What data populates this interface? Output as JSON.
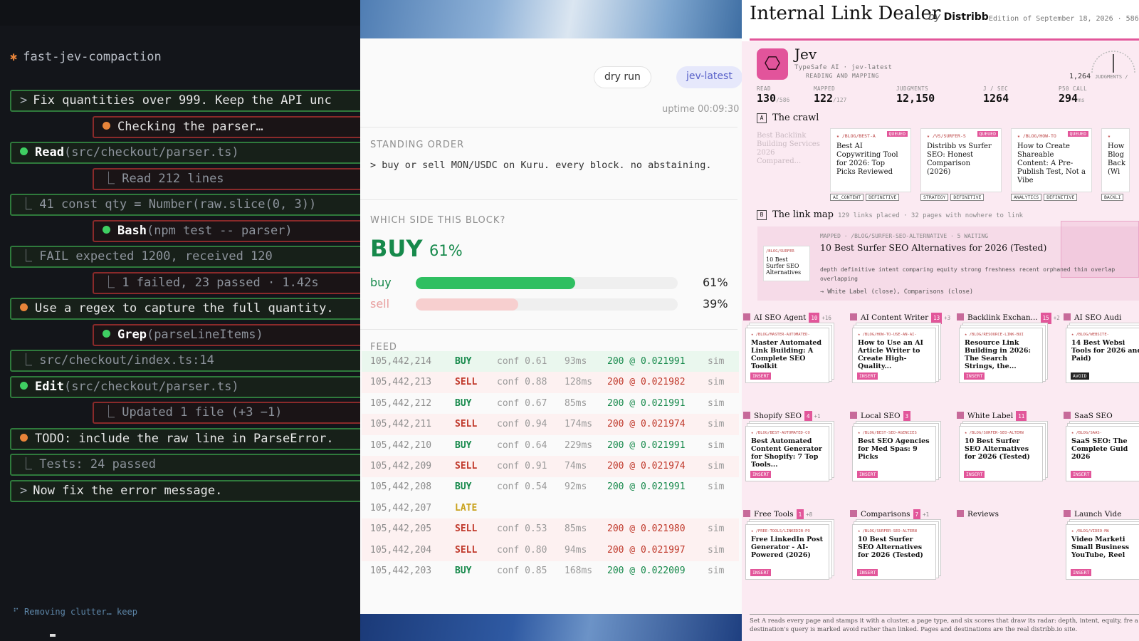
{
  "terminal": {
    "title": "fast-jev-compaction",
    "rows": [
      {
        "kind": "prompt",
        "text": "Fix quantities over 999. Keep the API unc"
      },
      {
        "kind": "sub-orange",
        "text": "Checking the parser…"
      },
      {
        "kind": "tool",
        "tool": "Read",
        "arg": "(src/checkout/parser.ts)"
      },
      {
        "kind": "sub",
        "text": "Read 212 lines"
      },
      {
        "kind": "out",
        "text": "41  const qty = Number(raw.slice(0, 3))"
      },
      {
        "kind": "subtool",
        "tool": "Bash",
        "arg": "(npm test -- parser)"
      },
      {
        "kind": "out",
        "text": "FAIL  expected 1200, received 120"
      },
      {
        "kind": "sub",
        "text": "1 failed, 23 passed · 1.42s"
      },
      {
        "kind": "note",
        "text": "Use a regex to capture the full quantity."
      },
      {
        "kind": "subtool",
        "tool": "Grep",
        "arg": "(parseLineItems)"
      },
      {
        "kind": "out",
        "text": "src/checkout/index.ts:14"
      },
      {
        "kind": "tool",
        "tool": "Edit",
        "arg": "(src/checkout/parser.ts)"
      },
      {
        "kind": "sub",
        "text": "Updated 1 file (+3 −1)"
      },
      {
        "kind": "note",
        "text": "TODO: include the raw line in ParseError."
      },
      {
        "kind": "out",
        "text": "Tests: 24 passed"
      },
      {
        "kind": "prompt",
        "text": "Now fix the error message."
      }
    ],
    "status": "Removing clutter… keep"
  },
  "trading": {
    "mode_button": "dry run",
    "model_tag": "jev-latest",
    "uptime": "uptime 00:09:30",
    "standing_order_label": "STANDING ORDER",
    "standing_order": "> buy or sell MON/USDC on Kuru. every block. no abstaining.",
    "side_label": "WHICH SIDE THIS BLOCK?",
    "side": "BUY",
    "side_pct": "61%",
    "buy_label": "buy",
    "buy_pct": "61%",
    "buy_value": 0.61,
    "sell_label": "sell",
    "sell_pct": "39%",
    "sell_value": 0.39,
    "feed_label": "FEED",
    "feed": [
      {
        "block": "105,442,214",
        "side": "BUY",
        "conf": "conf 0.61",
        "ms": "93ms",
        "fill": "200 @ 0.021991",
        "sim": "sim"
      },
      {
        "block": "105,442,213",
        "side": "SELL",
        "conf": "conf 0.88",
        "ms": "128ms",
        "fill": "200 @ 0.021982",
        "sim": "sim"
      },
      {
        "block": "105,442,212",
        "side": "BUY",
        "conf": "conf 0.67",
        "ms": "85ms",
        "fill": "200 @ 0.021991",
        "sim": "sim"
      },
      {
        "block": "105,442,211",
        "side": "SELL",
        "conf": "conf 0.94",
        "ms": "174ms",
        "fill": "200 @ 0.021974",
        "sim": "sim"
      },
      {
        "block": "105,442,210",
        "side": "BUY",
        "conf": "conf 0.64",
        "ms": "229ms",
        "fill": "200 @ 0.021991",
        "sim": "sim"
      },
      {
        "block": "105,442,209",
        "side": "SELL",
        "conf": "conf 0.91",
        "ms": "74ms",
        "fill": "200 @ 0.021974",
        "sim": "sim"
      },
      {
        "block": "105,442,208",
        "side": "BUY",
        "conf": "conf 0.54",
        "ms": "92ms",
        "fill": "200 @ 0.021991",
        "sim": "sim"
      },
      {
        "block": "105,442,207",
        "side": "LATE",
        "conf": "",
        "ms": "",
        "fill": "",
        "sim": ""
      },
      {
        "block": "105,442,205",
        "side": "SELL",
        "conf": "conf 0.53",
        "ms": "85ms",
        "fill": "200 @ 0.021980",
        "sim": "sim"
      },
      {
        "block": "105,442,204",
        "side": "SELL",
        "conf": "conf 0.80",
        "ms": "94ms",
        "fill": "200 @ 0.021997",
        "sim": "sim"
      },
      {
        "block": "105,442,203",
        "side": "BUY",
        "conf": "conf 0.85",
        "ms": "168ms",
        "fill": "200 @ 0.022009",
        "sim": "sim"
      }
    ]
  },
  "dealer": {
    "title": "Internal Link Dealer",
    "by": "by",
    "brand": "Distribb",
    "edition": "Edition of September 18, 2026 · 586 pa",
    "agent_name": "Jev",
    "agent_sub": "TypeSafe AI · jev-latest",
    "agent_state": "READING AND MAPPING",
    "gauge_value": "1,264",
    "gauge_unit": "JUDGMENTS /",
    "stats": [
      {
        "label": "READ",
        "value": "130",
        "of": "/586"
      },
      {
        "label": "MAPPED",
        "value": "122",
        "of": "/127"
      },
      {
        "label": "JUDGMENTS",
        "value": "12,150",
        "of": ""
      },
      {
        "label": "J / SEC",
        "value": "1264",
        "of": ""
      },
      {
        "label": "P50 CALL",
        "value": "294",
        "of": "ms"
      }
    ],
    "crawl_tag": "A",
    "crawl_title": "The crawl",
    "crawl_ghost": "Best Backlink Building Services 2026 Compared...",
    "crawl_cards": [
      {
        "path": "/BLOG/BEST-A",
        "status": "QUEUED",
        "title": "Best AI Copywriting Tool for 2026: Top Picks Reviewed",
        "chips": [
          "AI_CONTENT",
          "DEFINITIVE"
        ]
      },
      {
        "path": "/VS/SURFER-S",
        "status": "QUEUED",
        "title": "Distribb vs Surfer SEO: Honest Comparison (2026)",
        "chips": [
          "STRATEGY",
          "DEFINITIVE"
        ]
      },
      {
        "path": "/BLOG/HOW-TO",
        "status": "QUEUED",
        "title": "How to Create Shareable Content: A Pre-Publish Test, Not a Vibe",
        "chips": [
          "ANALYTICS",
          "DEFINITIVE"
        ]
      },
      {
        "path": "",
        "status": "",
        "title": "How Blog Back (Wi",
        "chips": [
          "BACKLI"
        ]
      }
    ],
    "map_tag": "B",
    "map_title": "The link map",
    "map_meta": "129 links placed · 32 pages with nowhere to link",
    "map_thumb_path": "/BLOG/SURFER",
    "map_thumb_title": "10 Best Surfer SEO Alternatives",
    "map_path": "MAPPED · /BLOG/SURFER-SEO-ALTERNATIVE · 5 WAITING",
    "map_heading": "10 Best Surfer SEO Alternatives for 2026 (Tested)",
    "map_scores": "depth definitive  intent comparing  equity strong  freshness recent  orphaned thin  overlap overlapping",
    "map_next": "→ White Label (close), Comparisons (close)",
    "clusters": [
      {
        "name": "AI SEO Agent",
        "count": "10",
        "plus": "+16",
        "path": "/BLOG/MASTER-AUTOMATED-",
        "title": "Master Automated Link Building: A Complete SEO Toolkit",
        "action": "INSERT"
      },
      {
        "name": "AI Content Writer",
        "count": "13",
        "plus": "+3",
        "path": "/BLOG/HOW-TO-USE-AN-AI-",
        "title": "How to Use an AI Article Writer to Create High-Quality...",
        "action": "INSERT"
      },
      {
        "name": "Backlink Exchan...",
        "count": "15",
        "plus": "+2",
        "path": "/BLOG/RESOURCE-LINK-BUI",
        "title": "Resource Link Building in 2026: The Search Strings, the...",
        "action": "INSERT"
      },
      {
        "name": "AI SEO Audi",
        "count": "",
        "plus": "",
        "path": "/BLOG/WEBSITE-",
        "title": "14 Best Websi Tools for 2026 and Paid)",
        "action": "AVOID"
      },
      {
        "name": "Shopify SEO",
        "count": "4",
        "plus": "+1",
        "path": "/BLOG/BEST-AUTOMATED-CO",
        "title": "Best Automated Content Generator for Shopify: 7 Top Tools...",
        "action": "INSERT"
      },
      {
        "name": "Local SEO",
        "count": "3",
        "plus": "",
        "path": "/BLOG/BEST-SEO-AGENCIES",
        "title": "Best SEO Agencies for Med Spas: 9 Picks",
        "action": "INSERT"
      },
      {
        "name": "White Label",
        "count": "11",
        "plus": "",
        "path": "/BLOG/SURFER-SEO-ALTERN",
        "title": "10 Best Surfer SEO Alternatives for 2026 (Tested)",
        "action": "INSERT"
      },
      {
        "name": "SaaS SEO",
        "count": "",
        "plus": "",
        "path": "/BLOG/SAAS-",
        "title": "SaaS SEO: The Complete Guid 2026",
        "action": "INSERT"
      },
      {
        "name": "Free Tools",
        "count": "1",
        "plus": "+8",
        "path": "/FREE-TOOLS/LINKEDIN-PO",
        "title": "Free LinkedIn Post Generator - AI-Powered (2026)",
        "action": "INSERT"
      },
      {
        "name": "Comparisons",
        "count": "7",
        "plus": "+1",
        "path": "/BLOG/SURFER-SEO-ALTERN",
        "title": "10 Best Surfer SEO Alternatives for 2026 (Tested)",
        "action": "INSERT"
      },
      {
        "name": "Reviews",
        "count": "",
        "plus": "",
        "path": "",
        "title": "",
        "action": ""
      },
      {
        "name": "Launch Vide",
        "count": "",
        "plus": "",
        "path": "/BLOG/VIDEO-MA",
        "title": "Video Marketi Small Business YouTube, Reel",
        "action": "INSERT"
      }
    ],
    "footnote": "Set A reads every page and stamps it with a cluster, a page type, and six scores that draw its radar: depth, intent, equity, fre a destination's query is marked avoid rather than linked. Pages and destinations are the real distribb.io site."
  },
  "colors": {
    "accent_green": "#16894b",
    "accent_red": "#c0392b",
    "brand_pink": "#e2569a",
    "term_green": "#2f7a3c",
    "term_red": "#8a2a2a"
  }
}
